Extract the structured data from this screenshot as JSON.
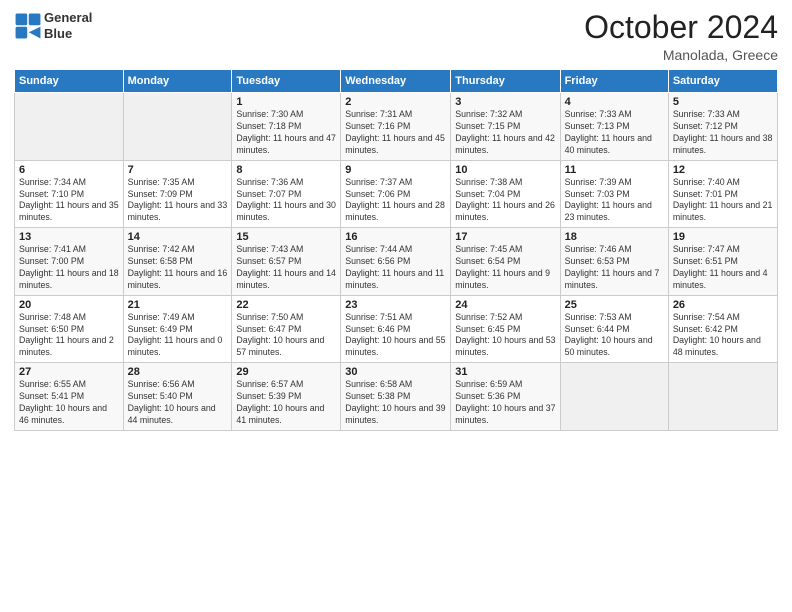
{
  "logo": {
    "line1": "General",
    "line2": "Blue"
  },
  "title": "October 2024",
  "subtitle": "Manolada, Greece",
  "days_of_week": [
    "Sunday",
    "Monday",
    "Tuesday",
    "Wednesday",
    "Thursday",
    "Friday",
    "Saturday"
  ],
  "weeks": [
    [
      {
        "day": "",
        "info": ""
      },
      {
        "day": "",
        "info": ""
      },
      {
        "day": "1",
        "info": "Sunrise: 7:30 AM\nSunset: 7:18 PM\nDaylight: 11 hours and 47 minutes."
      },
      {
        "day": "2",
        "info": "Sunrise: 7:31 AM\nSunset: 7:16 PM\nDaylight: 11 hours and 45 minutes."
      },
      {
        "day": "3",
        "info": "Sunrise: 7:32 AM\nSunset: 7:15 PM\nDaylight: 11 hours and 42 minutes."
      },
      {
        "day": "4",
        "info": "Sunrise: 7:33 AM\nSunset: 7:13 PM\nDaylight: 11 hours and 40 minutes."
      },
      {
        "day": "5",
        "info": "Sunrise: 7:33 AM\nSunset: 7:12 PM\nDaylight: 11 hours and 38 minutes."
      }
    ],
    [
      {
        "day": "6",
        "info": "Sunrise: 7:34 AM\nSunset: 7:10 PM\nDaylight: 11 hours and 35 minutes."
      },
      {
        "day": "7",
        "info": "Sunrise: 7:35 AM\nSunset: 7:09 PM\nDaylight: 11 hours and 33 minutes."
      },
      {
        "day": "8",
        "info": "Sunrise: 7:36 AM\nSunset: 7:07 PM\nDaylight: 11 hours and 30 minutes."
      },
      {
        "day": "9",
        "info": "Sunrise: 7:37 AM\nSunset: 7:06 PM\nDaylight: 11 hours and 28 minutes."
      },
      {
        "day": "10",
        "info": "Sunrise: 7:38 AM\nSunset: 7:04 PM\nDaylight: 11 hours and 26 minutes."
      },
      {
        "day": "11",
        "info": "Sunrise: 7:39 AM\nSunset: 7:03 PM\nDaylight: 11 hours and 23 minutes."
      },
      {
        "day": "12",
        "info": "Sunrise: 7:40 AM\nSunset: 7:01 PM\nDaylight: 11 hours and 21 minutes."
      }
    ],
    [
      {
        "day": "13",
        "info": "Sunrise: 7:41 AM\nSunset: 7:00 PM\nDaylight: 11 hours and 18 minutes."
      },
      {
        "day": "14",
        "info": "Sunrise: 7:42 AM\nSunset: 6:58 PM\nDaylight: 11 hours and 16 minutes."
      },
      {
        "day": "15",
        "info": "Sunrise: 7:43 AM\nSunset: 6:57 PM\nDaylight: 11 hours and 14 minutes."
      },
      {
        "day": "16",
        "info": "Sunrise: 7:44 AM\nSunset: 6:56 PM\nDaylight: 11 hours and 11 minutes."
      },
      {
        "day": "17",
        "info": "Sunrise: 7:45 AM\nSunset: 6:54 PM\nDaylight: 11 hours and 9 minutes."
      },
      {
        "day": "18",
        "info": "Sunrise: 7:46 AM\nSunset: 6:53 PM\nDaylight: 11 hours and 7 minutes."
      },
      {
        "day": "19",
        "info": "Sunrise: 7:47 AM\nSunset: 6:51 PM\nDaylight: 11 hours and 4 minutes."
      }
    ],
    [
      {
        "day": "20",
        "info": "Sunrise: 7:48 AM\nSunset: 6:50 PM\nDaylight: 11 hours and 2 minutes."
      },
      {
        "day": "21",
        "info": "Sunrise: 7:49 AM\nSunset: 6:49 PM\nDaylight: 11 hours and 0 minutes."
      },
      {
        "day": "22",
        "info": "Sunrise: 7:50 AM\nSunset: 6:47 PM\nDaylight: 10 hours and 57 minutes."
      },
      {
        "day": "23",
        "info": "Sunrise: 7:51 AM\nSunset: 6:46 PM\nDaylight: 10 hours and 55 minutes."
      },
      {
        "day": "24",
        "info": "Sunrise: 7:52 AM\nSunset: 6:45 PM\nDaylight: 10 hours and 53 minutes."
      },
      {
        "day": "25",
        "info": "Sunrise: 7:53 AM\nSunset: 6:44 PM\nDaylight: 10 hours and 50 minutes."
      },
      {
        "day": "26",
        "info": "Sunrise: 7:54 AM\nSunset: 6:42 PM\nDaylight: 10 hours and 48 minutes."
      }
    ],
    [
      {
        "day": "27",
        "info": "Sunrise: 6:55 AM\nSunset: 5:41 PM\nDaylight: 10 hours and 46 minutes."
      },
      {
        "day": "28",
        "info": "Sunrise: 6:56 AM\nSunset: 5:40 PM\nDaylight: 10 hours and 44 minutes."
      },
      {
        "day": "29",
        "info": "Sunrise: 6:57 AM\nSunset: 5:39 PM\nDaylight: 10 hours and 41 minutes."
      },
      {
        "day": "30",
        "info": "Sunrise: 6:58 AM\nSunset: 5:38 PM\nDaylight: 10 hours and 39 minutes."
      },
      {
        "day": "31",
        "info": "Sunrise: 6:59 AM\nSunset: 5:36 PM\nDaylight: 10 hours and 37 minutes."
      },
      {
        "day": "",
        "info": ""
      },
      {
        "day": "",
        "info": ""
      }
    ]
  ]
}
